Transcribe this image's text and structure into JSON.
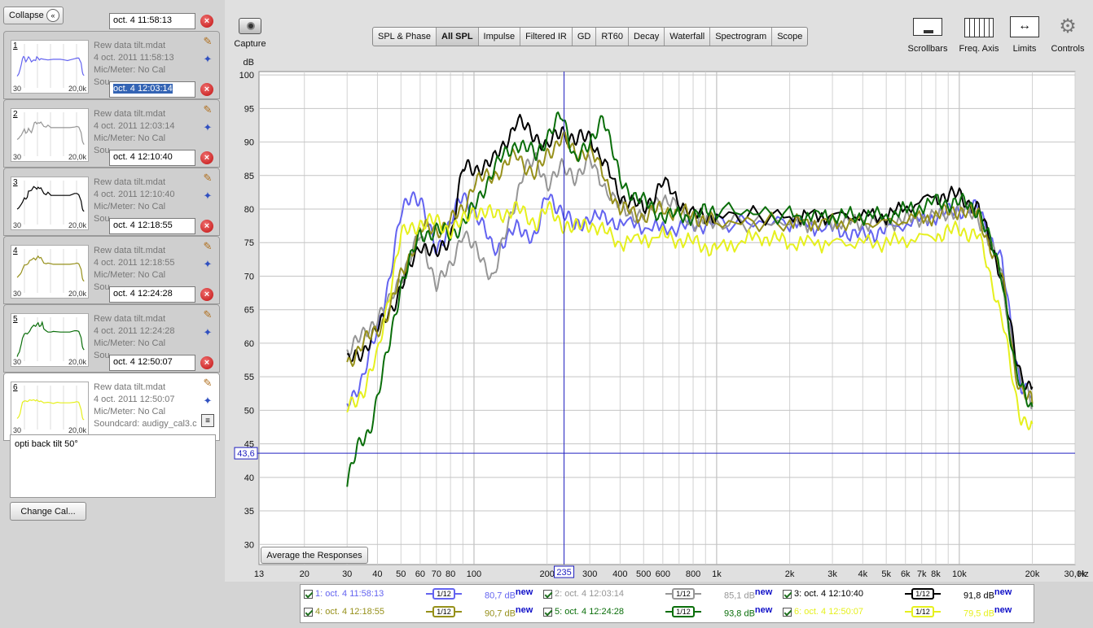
{
  "sidebar": {
    "collapse_label": "Collapse",
    "change_cal_label": "Change Cal...",
    "notes_text": "opti back tilt 50°",
    "thumb_lo": "30",
    "thumb_hi": "20,0k",
    "measurements": [
      {
        "num": "1",
        "tab": "oct. 4 11:58:13",
        "file": "Rew data tilt.mdat",
        "date": "4 oct. 2011 11:58:13",
        "mic": "Mic/Meter: No Cal",
        "sound": "Sou",
        "color": "#6464f0"
      },
      {
        "num": "2",
        "tab": "oct. 4 12:03:14",
        "file": "Rew data tilt.mdat",
        "date": "4 oct. 2011 12:03:14",
        "mic": "Mic/Meter: No Cal",
        "sound": "Sou",
        "color": "#969696"
      },
      {
        "num": "3",
        "tab": "oct. 4 12:10:40",
        "file": "Rew data tilt.mdat",
        "date": "4 oct. 2011 12:10:40",
        "mic": "Mic/Meter: No Cal",
        "sound": "Sou",
        "color": "#000000"
      },
      {
        "num": "4",
        "tab": "oct. 4 12:18:55",
        "file": "Rew data tilt.mdat",
        "date": "4 oct. 2011 12:18:55",
        "mic": "Mic/Meter: No Cal",
        "sound": "Sou",
        "color": "#96901a"
      },
      {
        "num": "5",
        "tab": "oct. 4 12:24:28",
        "file": "Rew data tilt.mdat",
        "date": "4 oct. 2011 12:24:28",
        "mic": "Mic/Meter: No Cal",
        "sound": "Sou",
        "color": "#0a6e0a"
      },
      {
        "num": "6",
        "tab": "oct. 4 12:50:07",
        "file": "Rew data tilt.mdat",
        "date": "4 oct. 2011 12:50:07",
        "mic": "Mic/Meter: No Cal",
        "sound": "Soundcard: audigy_cal3.c",
        "color": "#e6f01e"
      }
    ]
  },
  "toolbar": {
    "capture_label": "Capture",
    "tabs": [
      "SPL & Phase",
      "All SPL",
      "Impulse",
      "Filtered IR",
      "GD",
      "RT60",
      "Decay",
      "Waterfall",
      "Spectrogram",
      "Scope"
    ],
    "active_tab": "All SPL",
    "right_tools": [
      "Scrollbars",
      "Freq. Axis",
      "Limits",
      "Controls"
    ]
  },
  "graph": {
    "y_unit": "dB",
    "x_unit": "Hz",
    "cursor_x_label": "235",
    "cursor_y_label": "43,6",
    "average_button": "Average the Responses"
  },
  "legend": {
    "smoothing": "1/12",
    "entries": [
      {
        "label": "1: oct. 4 11:58:13",
        "level": "80,7 dB",
        "sup": "new",
        "color": "#6464f0"
      },
      {
        "label": "2: oct. 4 12:03:14",
        "level": "85,1 dB",
        "sup": "new",
        "color": "#969696"
      },
      {
        "label": "3: oct. 4 12:10:40",
        "level": "91,8 dB",
        "sup": "new",
        "color": "#000000"
      },
      {
        "label": "4: oct. 4 12:18:55",
        "level": "90,7 dB",
        "sup": "new",
        "color": "#96901a"
      },
      {
        "label": "5: oct. 4 12:24:28",
        "level": "93,8 dB",
        "sup": "new",
        "color": "#0a6e0a"
      },
      {
        "label": "6: oct. 4 12:50:07",
        "level": "79,5 dB",
        "sup": "new",
        "color": "#e6f01e"
      }
    ]
  },
  "chart_data": {
    "type": "line",
    "title": "",
    "xlabel": "Hz",
    "ylabel": "dB",
    "x_scale": "log",
    "xlim": [
      13,
      30000
    ],
    "ylim": [
      27,
      100.5
    ],
    "grid": true,
    "x_tick_labels": [
      "13",
      "20",
      "30",
      "40",
      "50",
      "60",
      "70",
      "80",
      "100",
      "200",
      "300",
      "400",
      "500",
      "600",
      "800",
      "1k",
      "2k",
      "3k",
      "4k",
      "5k",
      "6k",
      "7k",
      "8k",
      "10k",
      "20k",
      "30,0k"
    ],
    "y_tick_labels": [
      "30",
      "35",
      "40",
      "45",
      "50",
      "55",
      "60",
      "65",
      "70",
      "75",
      "80",
      "85",
      "90",
      "95",
      "100"
    ],
    "cursor": {
      "x": 235,
      "y": 43.6
    },
    "series": [
      {
        "name": "1: oct. 4 11:58:13",
        "color": "#6464f0",
        "points": [
          [
            30,
            51
          ],
          [
            35,
            55
          ],
          [
            40,
            62
          ],
          [
            45,
            70
          ],
          [
            50,
            79
          ],
          [
            55,
            82.5
          ],
          [
            60,
            81.5
          ],
          [
            65,
            77
          ],
          [
            70,
            74
          ],
          [
            80,
            78
          ],
          [
            90,
            82
          ],
          [
            100,
            80
          ],
          [
            120,
            74
          ],
          [
            150,
            77
          ],
          [
            180,
            76
          ],
          [
            200,
            82
          ],
          [
            230,
            80
          ],
          [
            260,
            77
          ],
          [
            300,
            79
          ],
          [
            400,
            78
          ],
          [
            600,
            77
          ],
          [
            1000,
            78
          ],
          [
            2000,
            78
          ],
          [
            3000,
            77
          ],
          [
            4000,
            76
          ],
          [
            5000,
            77
          ],
          [
            8000,
            79
          ],
          [
            10000,
            80
          ],
          [
            12000,
            80
          ],
          [
            15000,
            72
          ],
          [
            17000,
            58
          ],
          [
            18000,
            54
          ],
          [
            20000,
            52
          ]
        ]
      },
      {
        "name": "2: oct. 4 12:03:14",
        "color": "#969696",
        "points": [
          [
            30,
            59
          ],
          [
            35,
            61
          ],
          [
            40,
            64
          ],
          [
            45,
            66
          ],
          [
            50,
            70
          ],
          [
            60,
            76
          ],
          [
            70,
            69
          ],
          [
            80,
            71
          ],
          [
            90,
            77
          ],
          [
            100,
            74
          ],
          [
            120,
            70
          ],
          [
            140,
            78
          ],
          [
            160,
            86
          ],
          [
            180,
            87
          ],
          [
            200,
            84
          ],
          [
            230,
            86
          ],
          [
            260,
            85
          ],
          [
            300,
            87
          ],
          [
            400,
            80
          ],
          [
            500,
            79
          ],
          [
            600,
            82
          ],
          [
            800,
            78
          ],
          [
            1000,
            78
          ],
          [
            2000,
            78
          ],
          [
            3000,
            78
          ],
          [
            5000,
            78
          ],
          [
            8000,
            79
          ],
          [
            10000,
            80
          ],
          [
            12000,
            79
          ],
          [
            15000,
            70
          ],
          [
            17000,
            57
          ],
          [
            18000,
            54
          ],
          [
            20000,
            51
          ]
        ]
      },
      {
        "name": "3: oct. 4 12:10:40",
        "color": "#000000",
        "points": [
          [
            30,
            57
          ],
          [
            35,
            59
          ],
          [
            40,
            62
          ],
          [
            45,
            65
          ],
          [
            50,
            68
          ],
          [
            60,
            75
          ],
          [
            70,
            73
          ],
          [
            80,
            76
          ],
          [
            90,
            86
          ],
          [
            100,
            86
          ],
          [
            120,
            87
          ],
          [
            150,
            93
          ],
          [
            180,
            91
          ],
          [
            200,
            89
          ],
          [
            230,
            92
          ],
          [
            260,
            90
          ],
          [
            300,
            91
          ],
          [
            400,
            82
          ],
          [
            500,
            80
          ],
          [
            600,
            84
          ],
          [
            800,
            79
          ],
          [
            1000,
            79
          ],
          [
            2000,
            79
          ],
          [
            3000,
            79
          ],
          [
            5000,
            79
          ],
          [
            8000,
            82
          ],
          [
            10000,
            82
          ],
          [
            12000,
            80
          ],
          [
            15000,
            70
          ],
          [
            17000,
            58
          ],
          [
            18000,
            55
          ],
          [
            20000,
            53.5
          ]
        ]
      },
      {
        "name": "4: oct. 4 12:18:55",
        "color": "#96901a",
        "points": [
          [
            30,
            57
          ],
          [
            35,
            60
          ],
          [
            40,
            62
          ],
          [
            45,
            65
          ],
          [
            50,
            70
          ],
          [
            60,
            77
          ],
          [
            70,
            77
          ],
          [
            80,
            78
          ],
          [
            90,
            80
          ],
          [
            100,
            84
          ],
          [
            120,
            85
          ],
          [
            150,
            88
          ],
          [
            180,
            85
          ],
          [
            200,
            88
          ],
          [
            230,
            91
          ],
          [
            260,
            88
          ],
          [
            300,
            89
          ],
          [
            400,
            80
          ],
          [
            500,
            79
          ],
          [
            600,
            80
          ],
          [
            800,
            79
          ],
          [
            1000,
            78
          ],
          [
            2000,
            78
          ],
          [
            3000,
            78
          ],
          [
            5000,
            78
          ],
          [
            8000,
            79
          ],
          [
            10000,
            80
          ],
          [
            12000,
            79
          ],
          [
            15000,
            70
          ],
          [
            17000,
            56
          ],
          [
            18000,
            53
          ],
          [
            20000,
            51
          ]
        ]
      },
      {
        "name": "5: oct. 4 12:24:28",
        "color": "#0a6e0a",
        "points": [
          [
            30,
            39.5
          ],
          [
            33,
            44
          ],
          [
            37,
            47
          ],
          [
            40,
            52
          ],
          [
            45,
            60
          ],
          [
            50,
            69
          ],
          [
            60,
            76
          ],
          [
            70,
            77
          ],
          [
            80,
            76
          ],
          [
            90,
            78
          ],
          [
            100,
            80
          ],
          [
            120,
            86
          ],
          [
            150,
            90
          ],
          [
            180,
            88
          ],
          [
            200,
            91
          ],
          [
            230,
            93.8
          ],
          [
            260,
            88
          ],
          [
            300,
            89
          ],
          [
            340,
            94.5
          ],
          [
            400,
            84
          ],
          [
            500,
            81
          ],
          [
            600,
            79
          ],
          [
            800,
            79
          ],
          [
            1000,
            80
          ],
          [
            2000,
            79
          ],
          [
            3000,
            79
          ],
          [
            5000,
            79
          ],
          [
            8000,
            81
          ],
          [
            10000,
            81
          ],
          [
            12000,
            80
          ],
          [
            15000,
            70
          ],
          [
            17000,
            56
          ],
          [
            18000,
            53
          ],
          [
            20000,
            50.5
          ]
        ]
      },
      {
        "name": "6: oct. 4 12:50:07",
        "color": "#e6f01e",
        "points": [
          [
            30,
            50
          ],
          [
            35,
            53
          ],
          [
            40,
            58
          ],
          [
            45,
            68
          ],
          [
            50,
            76
          ],
          [
            60,
            78
          ],
          [
            70,
            78
          ],
          [
            80,
            77
          ],
          [
            90,
            78
          ],
          [
            100,
            80
          ],
          [
            120,
            79
          ],
          [
            150,
            80
          ],
          [
            180,
            78
          ],
          [
            200,
            80
          ],
          [
            230,
            78
          ],
          [
            260,
            77
          ],
          [
            300,
            78
          ],
          [
            400,
            75
          ],
          [
            600,
            76
          ],
          [
            800,
            75
          ],
          [
            1000,
            74
          ],
          [
            1500,
            76
          ],
          [
            2000,
            75
          ],
          [
            3000,
            75
          ],
          [
            5000,
            75
          ],
          [
            8000,
            76
          ],
          [
            10000,
            77
          ],
          [
            12000,
            76
          ],
          [
            15000,
            64
          ],
          [
            17000,
            52
          ],
          [
            18000,
            49
          ],
          [
            20000,
            48
          ]
        ]
      }
    ]
  }
}
